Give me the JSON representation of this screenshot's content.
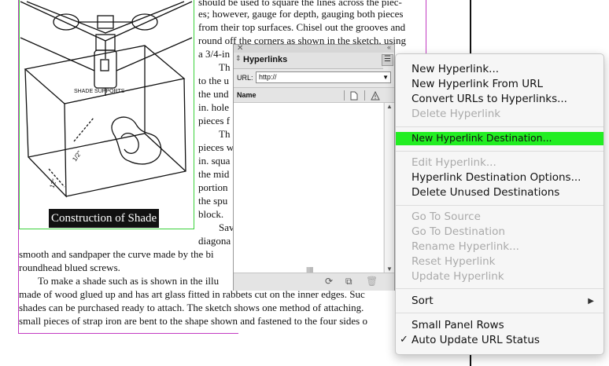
{
  "document": {
    "caption": "Construction of Shade",
    "figure_labels": {
      "shade_supports": "SHADE    SUPPORTS"
    },
    "right_column_lines": [
      "should be used to square the lines across the piec-",
      "es; however, gauge for depth, gauging both pieces",
      "from their top surfaces. Chisel out the grooves and",
      "round off the corners as shown in the sketch, using",
      "a 3/4-in"
    ],
    "right_column_fragments": [
      "Th",
      "to the u",
      "the und",
      "in. hole",
      "pieces f",
      "Th",
      "pieces w",
      "in. squa",
      "the mid",
      "portion",
      "the spu",
      "block.",
      "Sav",
      "diagona"
    ],
    "full_lines": [
      "smooth and sandpaper the curve made by the bi",
      "roundhead blued screws.",
      "To make a shade such as is shown in the illu",
      "made of wood glued up and has art glass fitted in rabbets cut on the inner edges. Suc",
      "shades can be purchased ready to attach. The sketch shows one method of attaching.",
      "small pieces of strap iron are bent to the shape shown and fastened to the four sides o"
    ]
  },
  "panel": {
    "title": "Hyperlinks",
    "url_label": "URL:",
    "url_value": "http://",
    "column_name": "Name"
  },
  "menu": {
    "items": [
      {
        "label": "New Hyperlink...",
        "enabled": true
      },
      {
        "label": "New Hyperlink From URL",
        "enabled": true
      },
      {
        "label": "Convert URLs to Hyperlinks...",
        "enabled": true
      },
      {
        "label": "Delete Hyperlink",
        "enabled": false
      },
      {
        "label": "New Hyperlink Destination...",
        "enabled": true,
        "highlighted": true
      },
      {
        "label": "Edit Hyperlink...",
        "enabled": false
      },
      {
        "label": "Hyperlink Destination Options...",
        "enabled": true
      },
      {
        "label": "Delete Unused Destinations",
        "enabled": true
      },
      {
        "label": "Go To Source",
        "enabled": false
      },
      {
        "label": "Go To Destination",
        "enabled": false
      },
      {
        "label": "Rename Hyperlink...",
        "enabled": false
      },
      {
        "label": "Reset Hyperlink",
        "enabled": false
      },
      {
        "label": "Update Hyperlink",
        "enabled": false
      },
      {
        "label": "Sort",
        "enabled": true,
        "submenu": true
      },
      {
        "label": "Small Panel Rows",
        "enabled": true
      },
      {
        "label": "Auto Update URL Status",
        "enabled": true,
        "checked": true
      }
    ],
    "highlight_color": "#22ee22"
  }
}
